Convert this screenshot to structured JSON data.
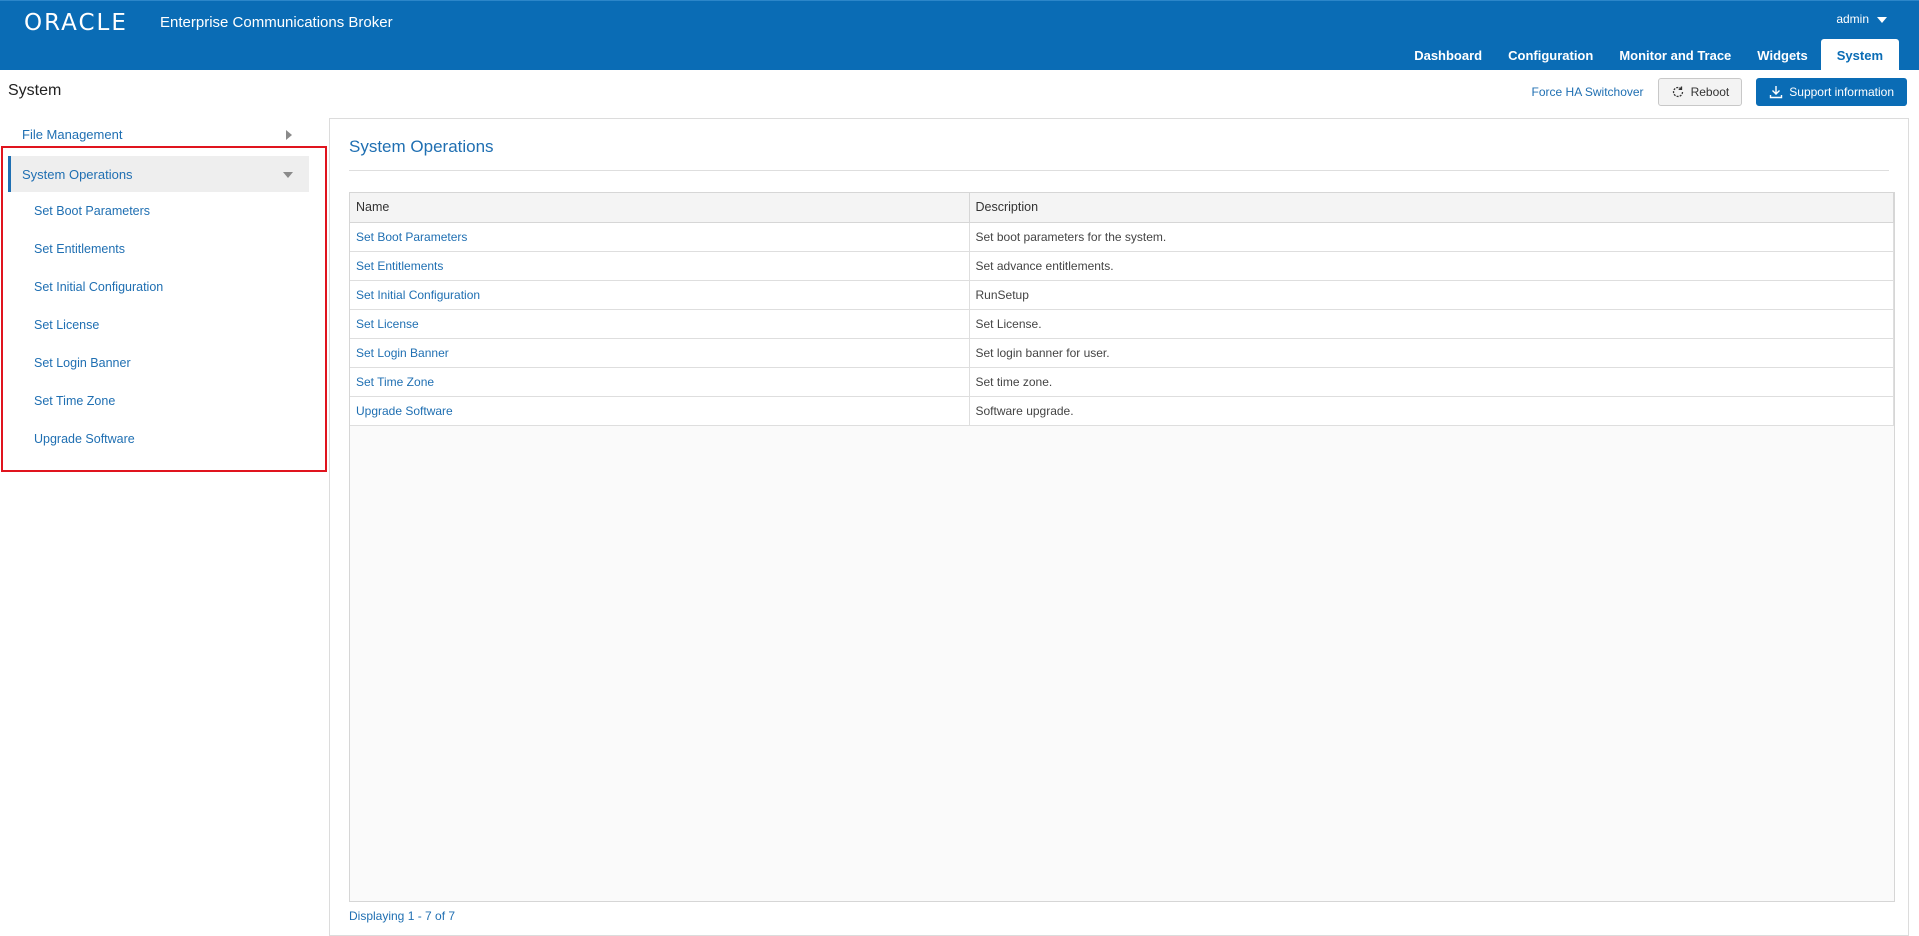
{
  "header": {
    "logo": "ORACLE",
    "product": "Enterprise Communications Broker",
    "user": "admin",
    "nav": [
      "Dashboard",
      "Configuration",
      "Monitor and Trace",
      "Widgets",
      "System"
    ],
    "active_nav": "System",
    "bg_color": "#0a6cb5"
  },
  "page": {
    "title": "System",
    "actions": {
      "ha_switchover": "Force HA Switchover",
      "reboot": "Reboot",
      "support": "Support information"
    }
  },
  "sidebar": {
    "file_management": "File Management",
    "section": "System Operations",
    "items": [
      "Set Boot Parameters",
      "Set Entitlements",
      "Set Initial Configuration",
      "Set License",
      "Set Login Banner",
      "Set Time Zone",
      "Upgrade Software"
    ],
    "highlight_color": "#e0141e"
  },
  "main": {
    "title": "System Operations",
    "table": {
      "headers": [
        "Name",
        "Description"
      ],
      "rows": [
        [
          "Set Boot Parameters",
          "Set boot parameters for the system."
        ],
        [
          "Set Entitlements",
          "Set advance entitlements."
        ],
        [
          "Set Initial Configuration",
          "RunSetup"
        ],
        [
          "Set License",
          "Set License."
        ],
        [
          "Set Login Banner",
          "Set login banner for user."
        ],
        [
          "Set Time Zone",
          "Set time zone."
        ],
        [
          "Upgrade Software",
          "Software upgrade."
        ]
      ]
    },
    "footer": "Displaying 1 - 7 of 7"
  }
}
